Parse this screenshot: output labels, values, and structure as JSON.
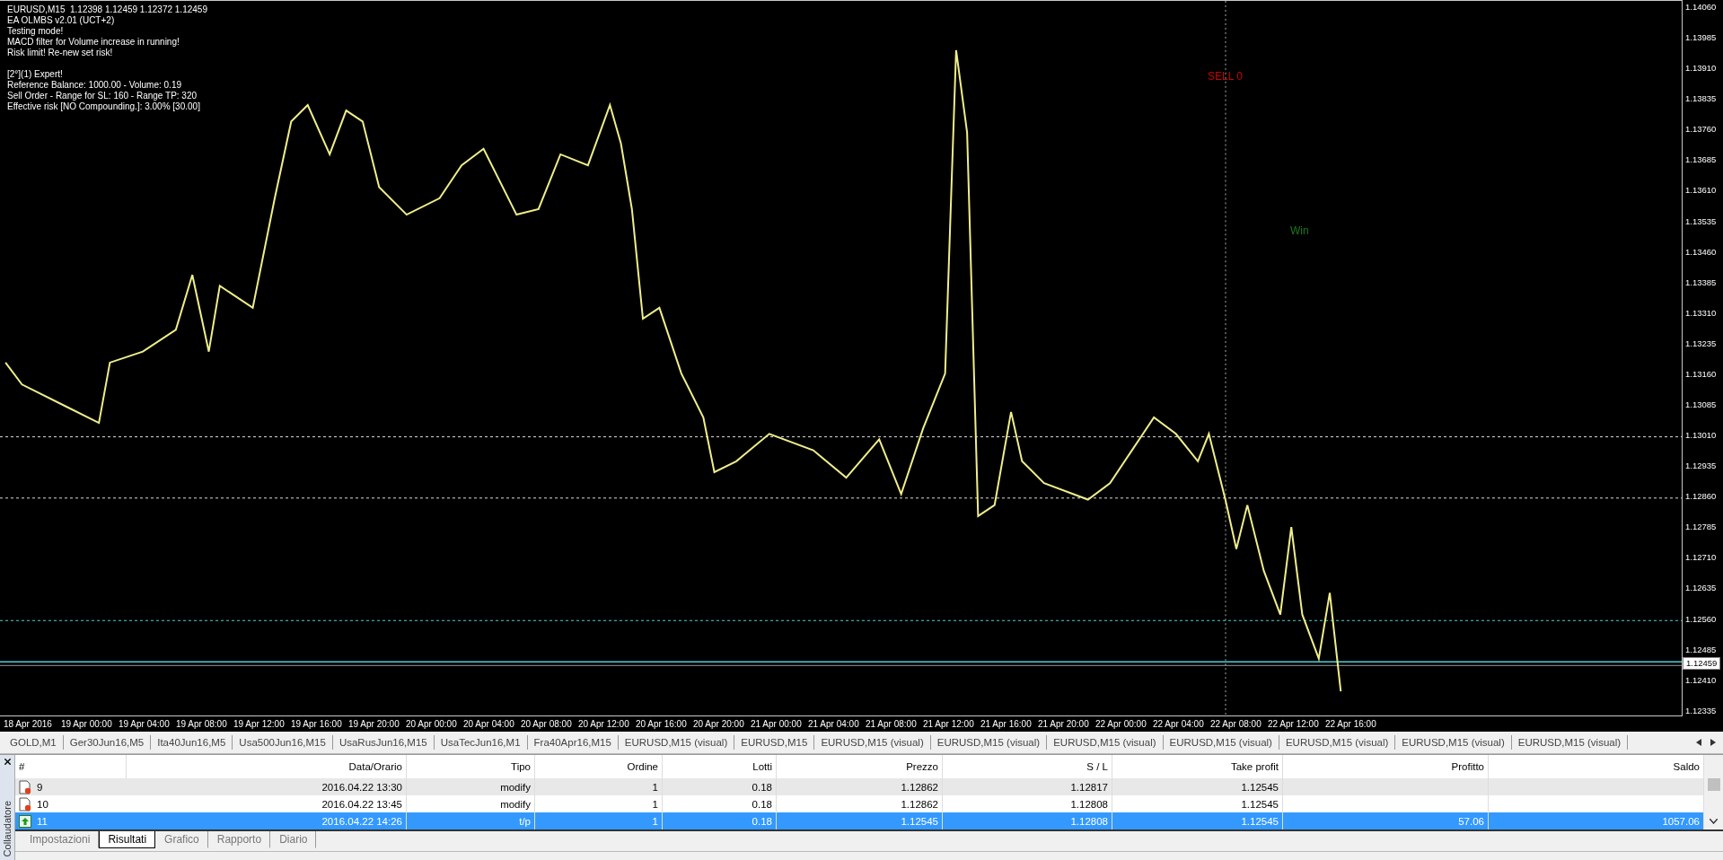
{
  "chart": {
    "info_lines": [
      "EURUSD,M15  1.12398 1.12459 1.12372 1.12459",
      "EA OLMBS v2.01 (UCT+2)",
      "Testing mode!",
      "MACD filter for Volume increase in running!",
      "Risk limit! Re-new set risk!"
    ],
    "expert_lines": [
      "[2°](1) Expert!",
      "Reference Balance: 1000.00 - Volume: 0.19",
      "Sell Order - Range for SL: 160 - Range TP: 320",
      "Effective risk [NO Compounding.]: 3.00% [30.00]"
    ],
    "labels": [
      {
        "text": "SELL 0",
        "color": "#cc0000"
      },
      {
        "text": "Win",
        "color": "#1a7a1a"
      }
    ],
    "price_axis": [
      "1.14060",
      "1.13985",
      "1.13910",
      "1.13835",
      "1.13760",
      "1.13685",
      "1.13610",
      "1.13535",
      "1.13460",
      "1.13385",
      "1.13310",
      "1.13235",
      "1.13160",
      "1.13085",
      "1.13010",
      "1.12935",
      "1.12860",
      "1.12785",
      "1.12710",
      "1.12635",
      "1.12560",
      "1.12485",
      "1.12410",
      "1.12335"
    ],
    "current_price": "1.12459",
    "time_axis": [
      "18 Apr 2016",
      "19 Apr 00:00",
      "19 Apr 04:00",
      "19 Apr 08:00",
      "19 Apr 12:00",
      "19 Apr 16:00",
      "19 Apr 20:00",
      "20 Apr 00:00",
      "20 Apr 04:00",
      "20 Apr 08:00",
      "20 Apr 12:00",
      "20 Apr 16:00",
      "20 Apr 20:00",
      "21 Apr 00:00",
      "21 Apr 04:00",
      "21 Apr 08:00",
      "21 Apr 12:00",
      "21 Apr 16:00",
      "21 Apr 20:00",
      "22 Apr 00:00",
      "22 Apr 04:00",
      "22 Apr 08:00",
      "22 Apr 12:00",
      "22 Apr 16:00"
    ]
  },
  "symbol_tabs": [
    {
      "label": "GOLD,M1",
      "selected": false
    },
    {
      "label": "Ger30Jun16,M5",
      "selected": false
    },
    {
      "label": "Ita40Jun16,M5",
      "selected": false
    },
    {
      "label": "Usa500Jun16,M15",
      "selected": false
    },
    {
      "label": "UsaRusJun16,M15",
      "selected": false
    },
    {
      "label": "UsaTecJun16,M1",
      "selected": false
    },
    {
      "label": "Fra40Apr16,M15",
      "selected": false
    },
    {
      "label": "EURUSD,M15 (visual)",
      "selected": false
    },
    {
      "label": "EURUSD,M15",
      "selected": false
    },
    {
      "label": "EURUSD,M15 (visual)",
      "selected": false
    },
    {
      "label": "EURUSD,M15 (visual)",
      "selected": false
    },
    {
      "label": "EURUSD,M15 (visual)",
      "selected": false
    },
    {
      "label": "EURUSD,M15 (visual)",
      "selected": false
    },
    {
      "label": "EURUSD,M15 (visual)",
      "selected": false
    },
    {
      "label": "EURUSD,M15 (visual)",
      "selected": false
    },
    {
      "label": "EURUSD,M15 (visual)",
      "selected": false
    }
  ],
  "tester": {
    "title": "Collaudatore",
    "columns": [
      "#",
      "Data/Orario",
      "Tipo",
      "Ordine",
      "Lotti",
      "Prezzo",
      "S / L",
      "Take profit",
      "Profitto",
      "Saldo"
    ],
    "rows": [
      {
        "kind": "modify",
        "selected": false,
        "number": "9",
        "time": "2016.04.22 13:30",
        "type": "modify",
        "order": "1",
        "lots": "0.18",
        "price": "1.12862",
        "sl": "1.12817",
        "tp": "1.12545"
      },
      {
        "kind": "modify",
        "selected": false,
        "number": "10",
        "time": "2016.04.22 13:45",
        "type": "modify",
        "order": "1",
        "lots": "0.18",
        "price": "1.12862",
        "sl": "1.12808",
        "tp": "1.12545"
      },
      {
        "kind": "tp",
        "selected": true,
        "number": "11",
        "time": "2016.04.22 14:26",
        "type": "t/p",
        "order": "1",
        "lots": "0.18",
        "price": "1.12545",
        "sl": "1.12808",
        "tp": "1.12545",
        "profit": "57.06",
        "balance": "1057.06"
      }
    ],
    "tabs": [
      {
        "label": "Impostazioni",
        "selected": false
      },
      {
        "label": "Risultati",
        "selected": true
      },
      {
        "label": "Grafico",
        "selected": false
      },
      {
        "label": "Rapporto",
        "selected": false
      },
      {
        "label": "Diario",
        "selected": false
      }
    ]
  }
}
